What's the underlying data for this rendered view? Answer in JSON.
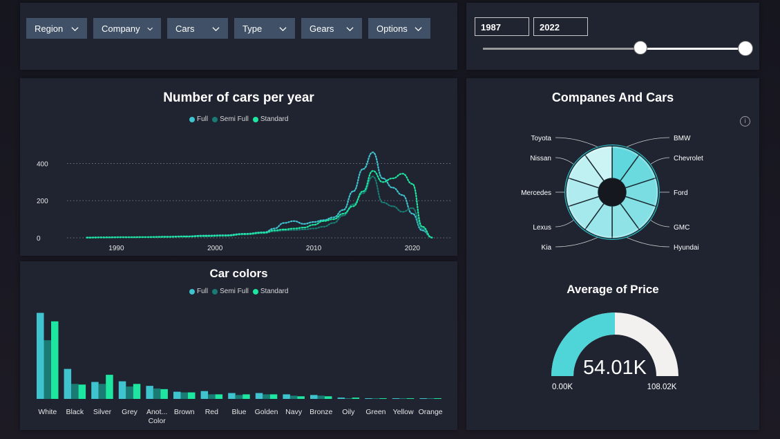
{
  "filters": {
    "slicers": [
      {
        "label": "Region"
      },
      {
        "label": "Company"
      },
      {
        "label": "Cars"
      },
      {
        "label": "Type"
      },
      {
        "label": "Gears"
      },
      {
        "label": "Options"
      }
    ],
    "year_range": {
      "start": "1987",
      "end": "2022",
      "start_fraction": 0.6,
      "end_fraction": 1.0
    }
  },
  "colors": {
    "full": "#3fc3cf",
    "semi_full": "#197b73",
    "standard": "#1ee6a0",
    "panel": "#1f2430",
    "slicer": "#3f5067"
  },
  "legend": {
    "full": "Full",
    "semi_full": "Semi Full",
    "standard": "Standard"
  },
  "line_chart": {
    "title": "Number of cars per year",
    "chart_data": {
      "type": "line",
      "title": "Number of cars per year",
      "x_ticks": [
        "1990",
        "2000",
        "2010",
        "2020"
      ],
      "y_ticks": [
        "0",
        "200",
        "400"
      ],
      "ylim": [
        0,
        450
      ],
      "xlim": [
        1985,
        2024
      ],
      "grid": true,
      "series": [
        {
          "name": "Full",
          "x": [
            1987,
            1989,
            1991,
            1993,
            1995,
            1997,
            1999,
            2001,
            2003,
            2005,
            2006,
            2007,
            2008,
            2009,
            2010,
            2011,
            2012,
            2013,
            2014,
            2015,
            2016,
            2017,
            2018,
            2019,
            2020,
            2021,
            2022
          ],
          "values": [
            2,
            3,
            4,
            4,
            6,
            8,
            12,
            14,
            22,
            30,
            50,
            80,
            90,
            75,
            85,
            95,
            110,
            150,
            250,
            370,
            460,
            320,
            270,
            230,
            130,
            40,
            2
          ]
        },
        {
          "name": "Semi Full",
          "x": [
            1987,
            1989,
            1991,
            1993,
            1995,
            1997,
            1999,
            2001,
            2003,
            2005,
            2006,
            2007,
            2008,
            2009,
            2010,
            2011,
            2012,
            2013,
            2014,
            2015,
            2016,
            2017,
            2018,
            2019,
            2020,
            2021,
            2022
          ],
          "values": [
            1,
            2,
            3,
            3,
            4,
            6,
            8,
            10,
            18,
            25,
            35,
            40,
            42,
            45,
            50,
            60,
            80,
            120,
            180,
            240,
            330,
            190,
            170,
            140,
            160,
            50,
            1
          ]
        },
        {
          "name": "Standard",
          "x": [
            1987,
            1989,
            1991,
            1993,
            1995,
            1997,
            1999,
            2001,
            2003,
            2005,
            2006,
            2007,
            2008,
            2009,
            2010,
            2011,
            2012,
            2013,
            2014,
            2015,
            2016,
            2017,
            2018,
            2019,
            2020,
            2021,
            2022
          ],
          "values": [
            1,
            2,
            3,
            4,
            5,
            7,
            10,
            12,
            20,
            28,
            40,
            45,
            50,
            55,
            70,
            90,
            100,
            130,
            170,
            250,
            360,
            300,
            320,
            345,
            290,
            60,
            1
          ]
        }
      ]
    }
  },
  "bar_chart": {
    "title": "Car colors",
    "chart_data": {
      "type": "bar",
      "title": "Car colors",
      "categories": [
        "White",
        "Black",
        "Silver",
        "Grey",
        "Another Color",
        "Brown",
        "Red",
        "Blue",
        "Golden",
        "Navy",
        "Bronze",
        "Oily",
        "Green",
        "Yellow",
        "Orange"
      ],
      "category_labels": [
        [
          "White"
        ],
        [
          "Black"
        ],
        [
          "Silver"
        ],
        [
          "Grey"
        ],
        [
          "Anot...",
          "Color"
        ],
        [
          "Brown"
        ],
        [
          "Red"
        ],
        [
          "Blue"
        ],
        [
          "Golden"
        ],
        [
          "Navy"
        ],
        [
          "Bronze"
        ],
        [
          "Oily"
        ],
        [
          "Green"
        ],
        [
          "Yellow"
        ],
        [
          "Orange"
        ]
      ],
      "series": [
        {
          "name": "Full",
          "values": [
            132,
            46,
            26,
            27,
            20,
            11,
            12,
            9,
            9,
            7,
            6,
            2,
            1,
            1,
            1
          ]
        },
        {
          "name": "Semi Full",
          "values": [
            90,
            23,
            23,
            19,
            16,
            10,
            7,
            6,
            7,
            5,
            5,
            1,
            1,
            1,
            1
          ]
        },
        {
          "name": "Standard",
          "values": [
            119,
            22,
            37,
            23,
            15,
            10,
            7,
            7,
            7,
            4,
            4,
            2,
            1,
            1,
            1
          ]
        }
      ],
      "ylim": [
        0,
        140
      ]
    }
  },
  "donut": {
    "title": "Companes And Cars",
    "info_icon": "info-icon",
    "chart_data": {
      "type": "pie",
      "title": "Companes And Cars",
      "labels": [
        "BMW",
        "Chevrolet",
        "Ford",
        "GMC",
        "Hyundai",
        "Kia",
        "Lexus",
        "Mercedes",
        "Nissan",
        "Toyota"
      ],
      "values": [
        10,
        10,
        10,
        10,
        10,
        10,
        10,
        10,
        10,
        10
      ]
    }
  },
  "gauge": {
    "title": "Average of Price",
    "value_label": "54.01K",
    "min_label": "0.00K",
    "max_label": "108.02K",
    "chart_data": {
      "type": "gauge",
      "value": 54.01,
      "min": 0,
      "max": 108.02
    }
  }
}
